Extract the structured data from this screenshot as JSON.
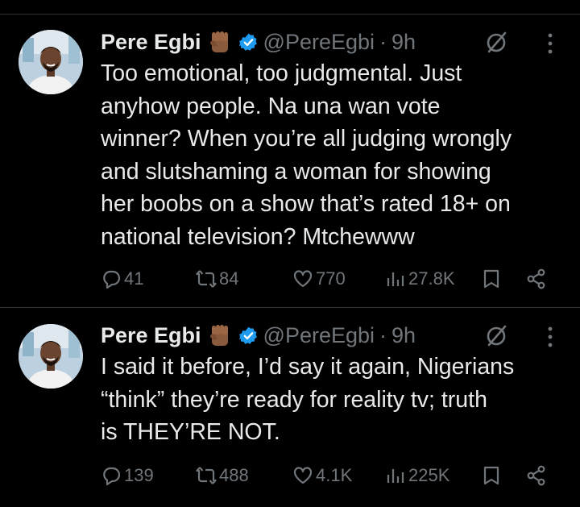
{
  "tweets": [
    {
      "author": {
        "name": "Pere Egbi",
        "handle": "@PereEgbi",
        "time": "9h",
        "separator": "·",
        "badge_icon": "raised-fist-emoji-icon",
        "verified_icon": "verified-badge-icon",
        "verified_color": "#1d9bf0"
      },
      "text": "Too emotional, too judgmental. Just\nanyhow people. Na una wan vote\nwinner? When you’re all judging wrongly\nand slutshaming a woman for showing\nher boobs on a show that’s rated 18+ on\nnational television? Mtchewww",
      "stats": {
        "replies": "41",
        "reposts": "84",
        "likes": "770",
        "views": "27.8K"
      }
    },
    {
      "author": {
        "name": "Pere Egbi",
        "handle": "@PereEgbi",
        "time": "9h",
        "separator": "·",
        "badge_icon": "raised-fist-emoji-icon",
        "verified_icon": "verified-badge-icon",
        "verified_color": "#1d9bf0"
      },
      "text": "I said it before, I’d say it again, Nigerians\n“think” they’re ready for reality tv; truth\nis THEY’RE NOT.",
      "stats": {
        "replies": "139",
        "reposts": "488",
        "likes": "4.1K",
        "views": "225K"
      }
    }
  ],
  "colors": {
    "background": "#000000",
    "text": "#e7e9ea",
    "muted": "#71767b",
    "divider": "#2f3336",
    "accent": "#1d9bf0"
  }
}
